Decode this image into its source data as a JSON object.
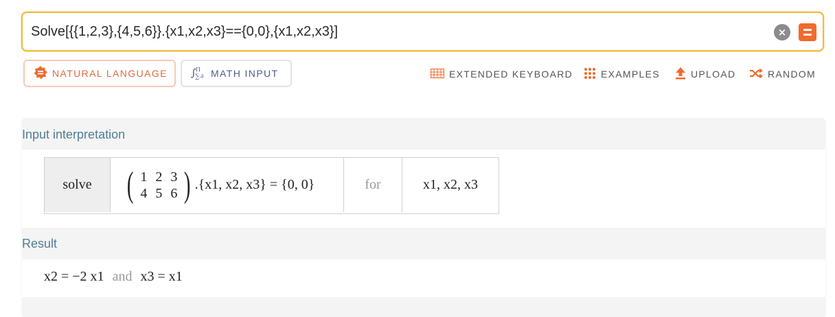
{
  "search": {
    "query": "Solve[{{1,2,3},{4,5,6}}.{x1,x2,x3}=={0,0},{x1,x2,x3}]",
    "clear_icon": "close-icon",
    "go_icon": "equals-icon"
  },
  "modes": {
    "natural_language": "NATURAL LANGUAGE",
    "math_input": "MATH INPUT"
  },
  "tools": {
    "extended_keyboard": "EXTENDED KEYBOARD",
    "examples": "EXAMPLES",
    "upload": "UPLOAD",
    "random": "RANDOM"
  },
  "colors": {
    "accent_orange": "#f26a2e",
    "search_border": "#f5b83d",
    "pod_title": "#4f7f96"
  },
  "pods": {
    "input_interpretation": {
      "title": "Input interpretation",
      "solve": "solve",
      "matrix_row1": [
        "1",
        "2",
        "3"
      ],
      "matrix_row2": [
        "4",
        "5",
        "6"
      ],
      "expr_tail": ".{x1, x2, x3} = {0, 0}",
      "for": "for",
      "vars": "x1, x2, x3"
    },
    "result": {
      "title": "Result",
      "left": "x2 = −2 x1",
      "and": "and",
      "right": "x3 = x1"
    }
  }
}
